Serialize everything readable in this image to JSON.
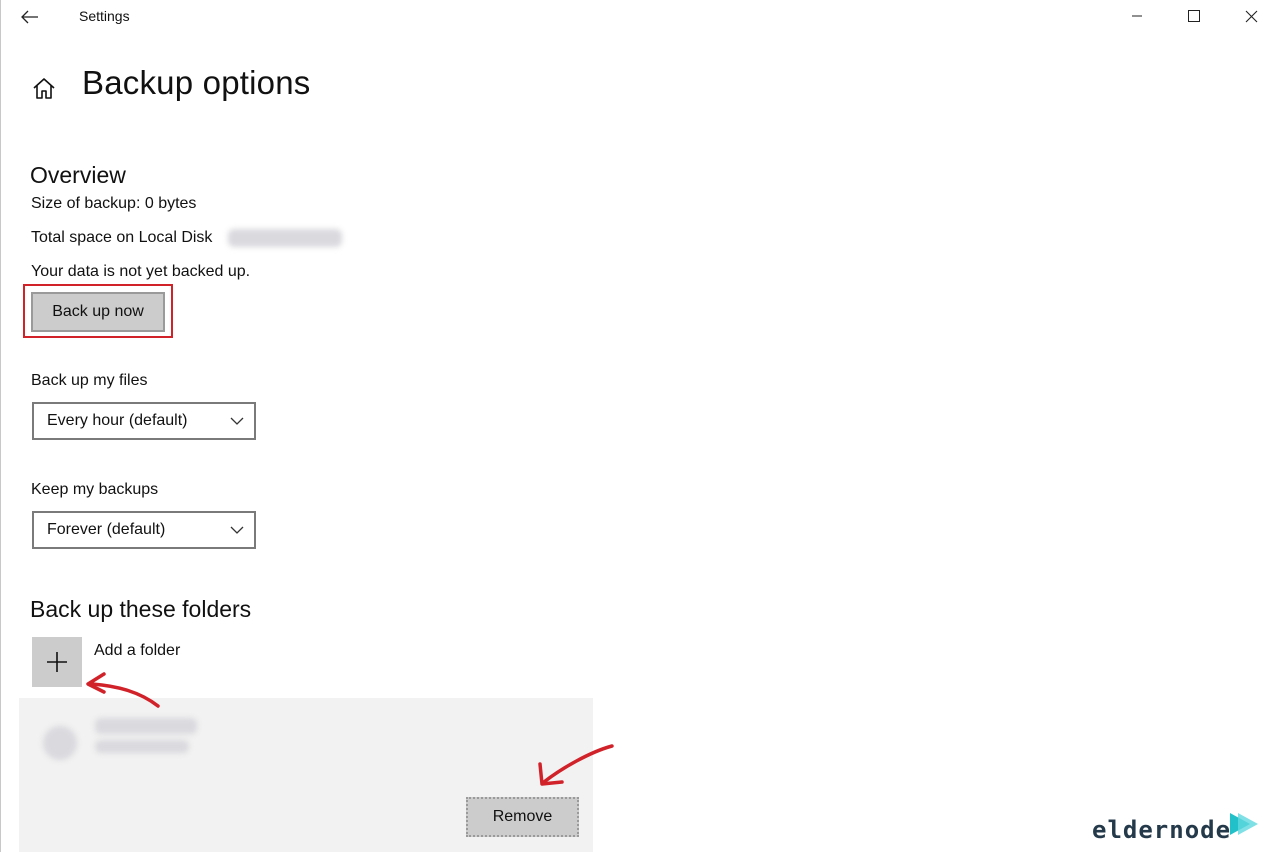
{
  "window": {
    "app_title": "Settings",
    "back_icon": "arrow-left-icon",
    "controls": [
      "minimize-icon",
      "maximize-icon",
      "close-icon"
    ]
  },
  "page": {
    "home_icon": "home-icon",
    "title": "Backup options"
  },
  "overview": {
    "heading": "Overview",
    "size_label": "Size of backup: 0 bytes",
    "total_space_label": "Total space on Local Disk",
    "status_text": "Your data is not yet backed up.",
    "backup_now_label": "Back up now"
  },
  "frequency": {
    "label": "Back up my files",
    "selected": "Every hour (default)"
  },
  "retention": {
    "label": "Keep my backups",
    "selected": "Forever (default)"
  },
  "folders": {
    "heading": "Back up these folders",
    "add_label": "Add a folder",
    "remove_label": "Remove"
  },
  "colors": {
    "annotation_red": "#d1222a",
    "button_gray": "#cccccc",
    "panel_gray": "#f2f2f2"
  },
  "watermark": {
    "text": "eldernode"
  }
}
